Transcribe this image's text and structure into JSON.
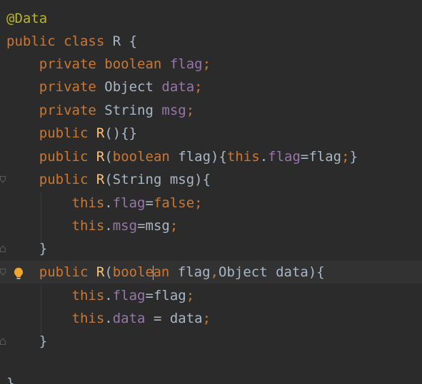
{
  "code": {
    "annotation": "@Data",
    "kw_public": "public",
    "kw_class": "class",
    "kw_private": "private",
    "kw_boolean": "boolean",
    "kw_this": "this",
    "kw_false": "false",
    "class_name": "R",
    "type_object": "Object",
    "type_string": "String",
    "field_flag": "flag",
    "field_data": "data",
    "field_msg": "msg",
    "boolean_prefix": "boole",
    "boolean_suffix": "an",
    "method_r": "R",
    "brace_open": " {",
    "brace_close": "}",
    "semicolon": ";",
    "dot": ".",
    "empty_ctor_tail": "(){}",
    "paren_open": "(",
    "param_flag_close": " flag){",
    "param_msg_close": " msg){",
    "param_flag_comma": " flag",
    "comma": ",",
    "param_data_close": " data){",
    "assign_flag": "=flag",
    "assign_false": "=",
    "assign_msg": "=msg",
    "assign_data": " = data",
    "closing_brace": "}",
    "ctor_body_open": "{",
    "ctor_body_close": "}"
  },
  "gutter": {
    "intention_icon": "lightbulb-icon",
    "fold_icon": "fold-marker-icon"
  },
  "colors": {
    "background": "#2b2b2b",
    "keyword": "#cc7832",
    "field": "#9876aa",
    "annotation": "#bbb529",
    "method": "#ffc66d",
    "text": "#a9b7c6"
  }
}
